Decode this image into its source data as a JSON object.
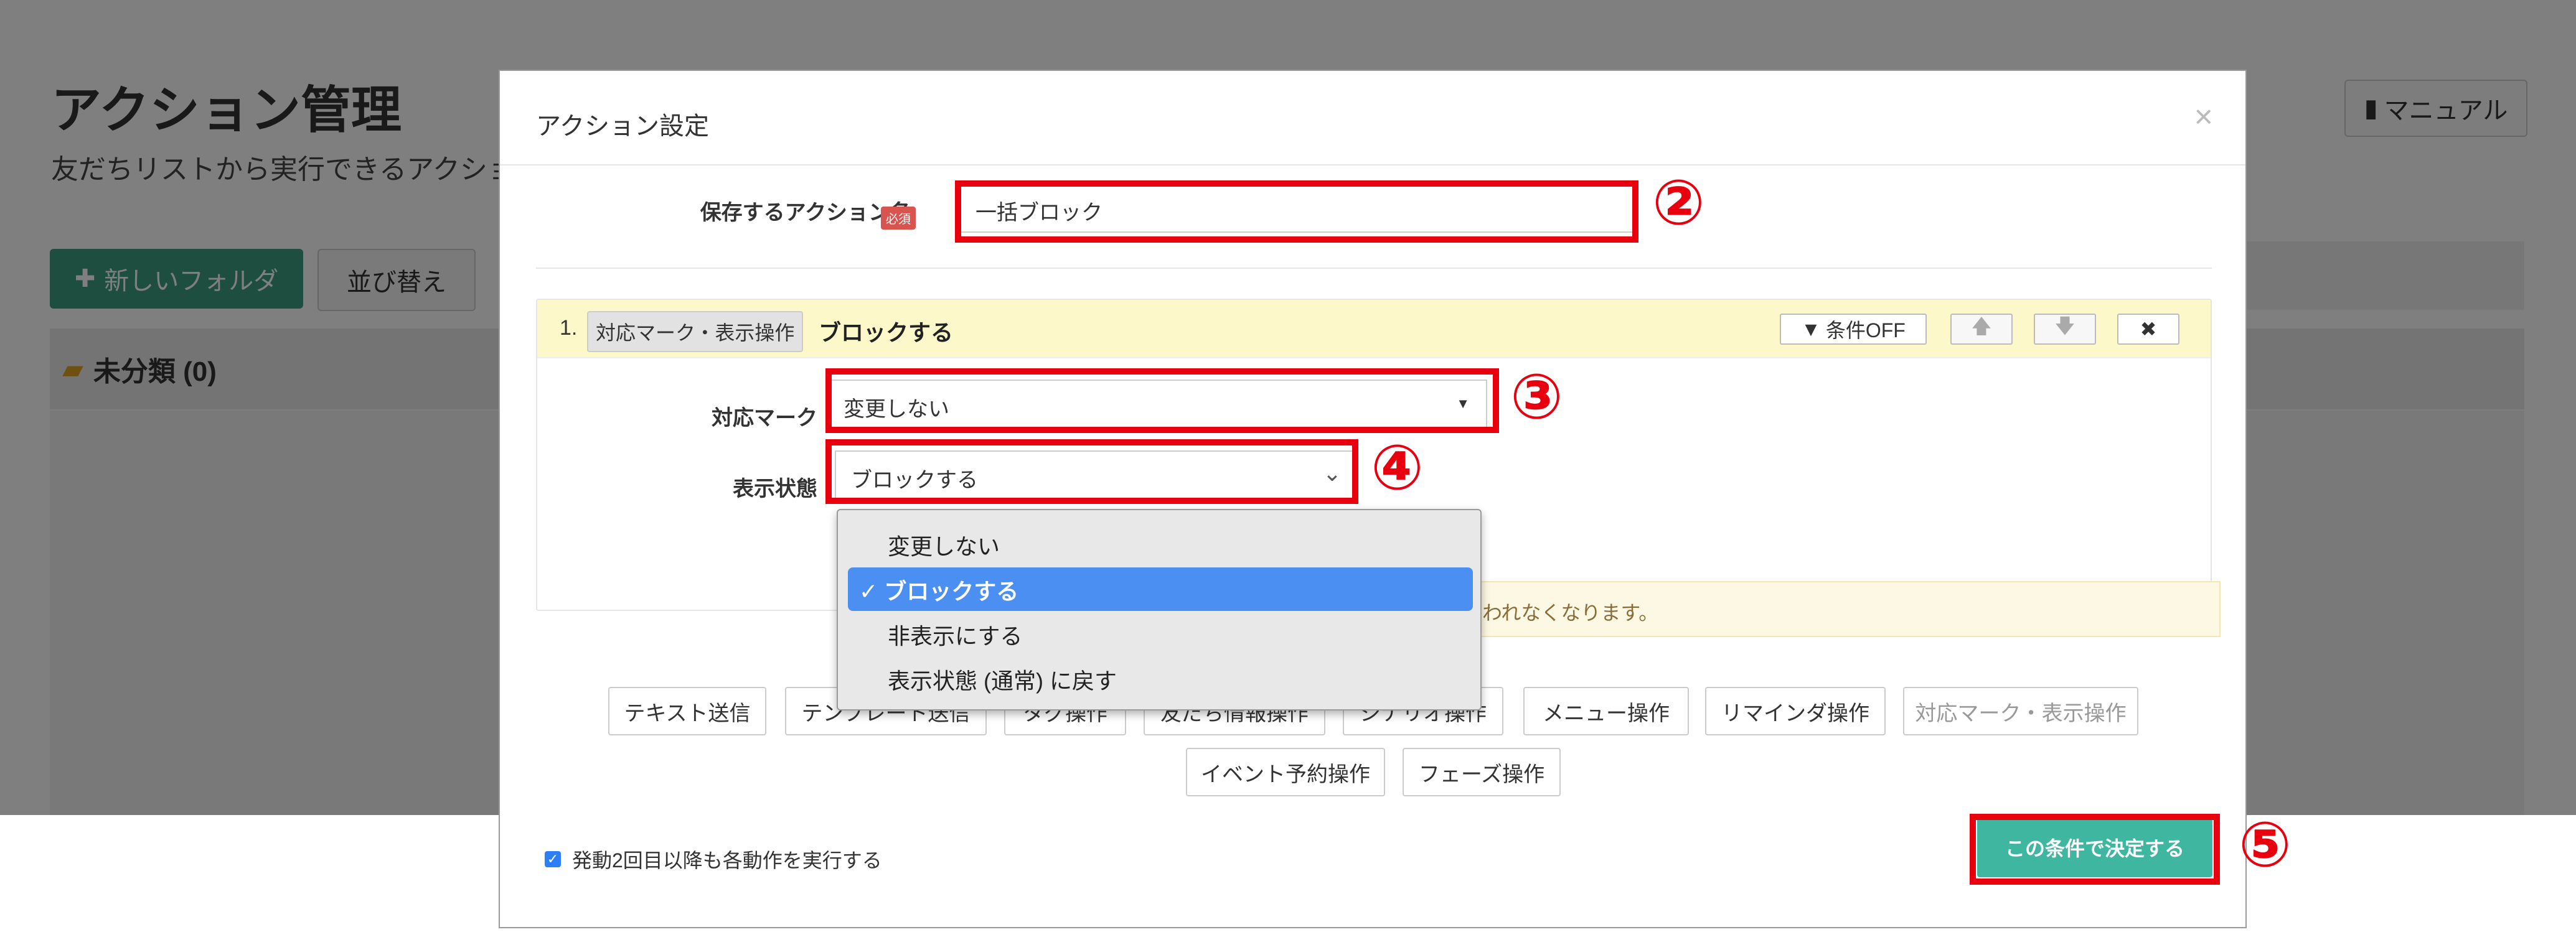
{
  "background": {
    "title": "アクション管理",
    "subtitle": "友だちリストから実行できるアクショ",
    "new_folder_label": "新しいフォルダ",
    "sort_label": "並び替え",
    "manual_label": "マニュアル",
    "folder_label": "未分類 (0)"
  },
  "modal": {
    "title": "アクション設定",
    "close_symbol": "×",
    "name_label": "保存するアクション名",
    "required_badge": "必須",
    "name_value": "一括ブロック",
    "action": {
      "number": "1.",
      "tag": "対応マーク・表示操作",
      "name": "ブロックする",
      "condition_label": "条件OFF",
      "up_symbol": "🡅",
      "down_symbol": "🡇",
      "delete_symbol": "✖",
      "mark_label": "対応マーク",
      "mark_value": "変更しない",
      "display_label": "表示状態",
      "display_value": "ブロックする",
      "notice_text": "われなくなります。"
    },
    "operations_row1": [
      "テキスト送信",
      "テンプレート送信",
      "タグ操作",
      "友だち情報操作",
      "シナリオ操作",
      "メニュー操作",
      "リマインダ操作",
      "対応マーク・表示操作"
    ],
    "operations_row2": [
      "イベント予約操作",
      "フェーズ操作"
    ],
    "repeat_label": "発動2回目以降も各動作を実行する",
    "decide_label": "この条件で決定する"
  },
  "dropdown": {
    "options": [
      "変更しない",
      "ブロックする",
      "非表示にする",
      "表示状態 (通常) に戻す"
    ],
    "selected": "ブロックする",
    "check_symbol": "✓"
  },
  "annotations": [
    "②",
    "③",
    "④",
    "⑤"
  ],
  "colors": {
    "highlight": "#e8000f",
    "accent": "#3fb6a0",
    "selected": "#4c8ff2"
  }
}
